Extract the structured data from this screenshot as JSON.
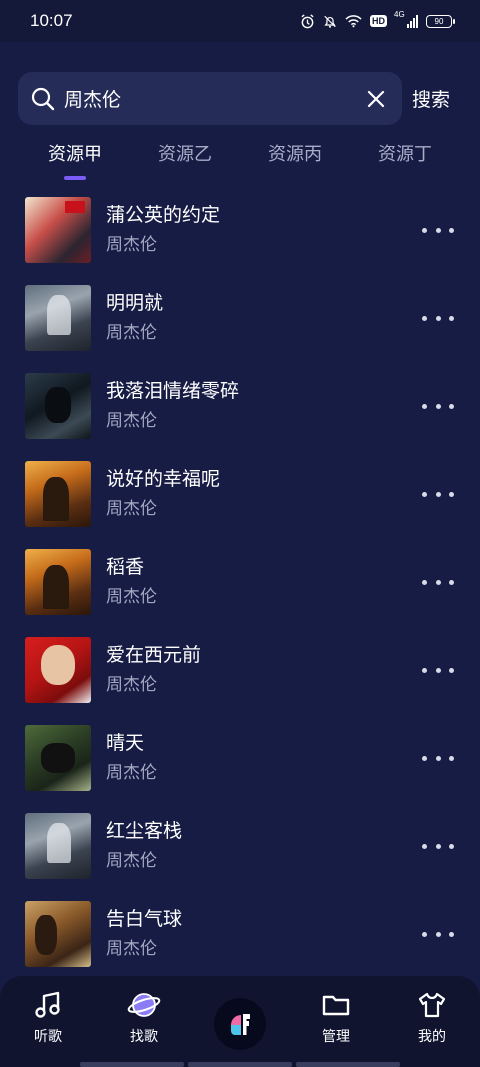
{
  "status_bar": {
    "time": "10:07",
    "network": "4G",
    "hd": "HD",
    "battery": "90",
    "icons": [
      "alarm-icon",
      "mute-icon",
      "wifi-icon",
      "hd-icon",
      "signal-icon",
      "battery-icon"
    ]
  },
  "search": {
    "query": "周杰伦",
    "placeholder": "",
    "button_label": "搜索"
  },
  "tabs": [
    {
      "label": "资源甲",
      "active": true
    },
    {
      "label": "资源乙",
      "active": false
    },
    {
      "label": "资源丙",
      "active": false
    },
    {
      "label": "资源丁",
      "active": false
    }
  ],
  "songs": [
    {
      "title": "蒲公英的约定",
      "artist": "周杰伦"
    },
    {
      "title": "明明就",
      "artist": "周杰伦"
    },
    {
      "title": "我落泪情绪零碎",
      "artist": "周杰伦"
    },
    {
      "title": "说好的幸福呢",
      "artist": "周杰伦"
    },
    {
      "title": "稻香",
      "artist": "周杰伦"
    },
    {
      "title": "爱在西元前",
      "artist": "周杰伦"
    },
    {
      "title": "晴天",
      "artist": "周杰伦"
    },
    {
      "title": "红尘客栈",
      "artist": "周杰伦"
    },
    {
      "title": "告白气球",
      "artist": "周杰伦"
    }
  ],
  "bottom_nav": [
    {
      "label": "听歌",
      "icon": "music-note-icon"
    },
    {
      "label": "找歌",
      "icon": "planet-icon"
    },
    {
      "label": "",
      "icon": "app-logo-icon"
    },
    {
      "label": "管理",
      "icon": "folder-icon"
    },
    {
      "label": "我的",
      "icon": "tshirt-icon"
    }
  ],
  "colors": {
    "background": "#171c45",
    "accent": "#7c5cf6",
    "search_bg": "#262c58"
  }
}
